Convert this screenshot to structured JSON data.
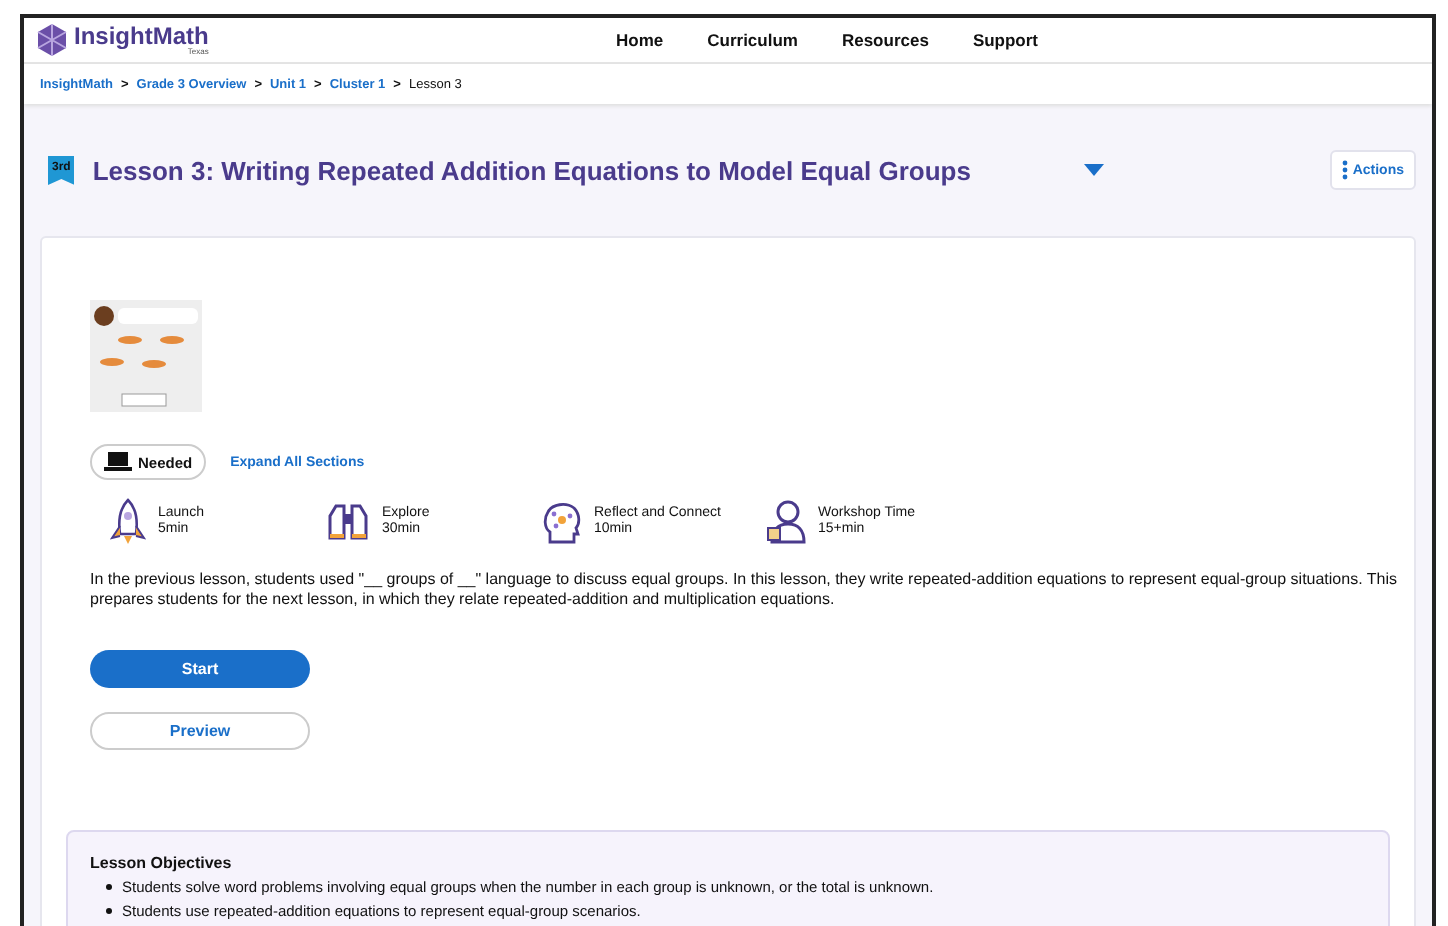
{
  "header": {
    "logo": "InsightMath",
    "logo_sub": "Texas",
    "nav": [
      "Home",
      "Curriculum",
      "Resources",
      "Support"
    ]
  },
  "breadcrumb": {
    "links": [
      "InsightMath",
      "Grade 3 Overview",
      "Unit 1",
      "Cluster 1"
    ],
    "separator": ">",
    "current": "Lesson 3"
  },
  "lesson": {
    "grade_badge": "3rd",
    "title": "Lesson 3: Writing Repeated Addition Equations to Model Equal Groups",
    "actions": "Actions",
    "device_pill": "Needed",
    "expand_link": "Expand All Sections",
    "activities": [
      {
        "kind": "rocket",
        "name": "Launch",
        "time": "5min"
      },
      {
        "kind": "binoculars",
        "name": "Explore",
        "time": "30min"
      },
      {
        "kind": "head",
        "name": "Reflect and Connect",
        "time": "10min"
      },
      {
        "kind": "person",
        "name": "Workshop Time",
        "time": "15+min"
      }
    ],
    "summary": "In the previous lesson, students used \"__ groups of __\" language to discuss equal groups. In this lesson, they write repeated-addition equations to represent equal-group situations. This prepares students for the next lesson, in which they relate repeated-addition and multiplication equations.",
    "start_button": "Start",
    "preview_button": "Preview"
  },
  "objectives": {
    "heading": "Lesson Objectives",
    "items": [
      "Students solve word problems involving equal groups when the number in each group is unknown, or the total is unknown.",
      "Students use repeated-addition equations to represent equal-group scenarios."
    ]
  }
}
